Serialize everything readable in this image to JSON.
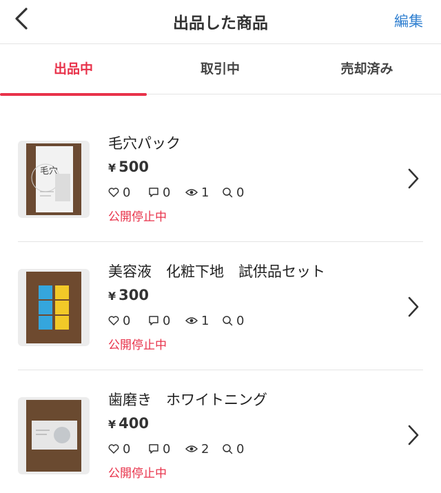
{
  "header": {
    "title": "出品した商品",
    "edit_label": "編集",
    "back_icon": "chevron-left-icon"
  },
  "tabs": [
    {
      "label": "出品中",
      "active": true
    },
    {
      "label": "取引中",
      "active": false
    },
    {
      "label": "売却済み",
      "active": false
    }
  ],
  "colors": {
    "accent": "#e8324a",
    "link": "#2f7fd0"
  },
  "items": [
    {
      "title": "毛穴パック",
      "currency": "¥",
      "price": "500",
      "likes": "0",
      "comments": "0",
      "views": "1",
      "searches": "0",
      "status": "公開停止中",
      "thumb_text": "毛穴"
    },
    {
      "title": "美容液　化粧下地　試供品セット",
      "currency": "¥",
      "price": "300",
      "likes": "0",
      "comments": "0",
      "views": "1",
      "searches": "0",
      "status": "公開停止中"
    },
    {
      "title": "歯磨き　ホワイトニング",
      "currency": "¥",
      "price": "400",
      "likes": "0",
      "comments": "0",
      "views": "2",
      "searches": "0",
      "status": "公開停止中"
    }
  ]
}
